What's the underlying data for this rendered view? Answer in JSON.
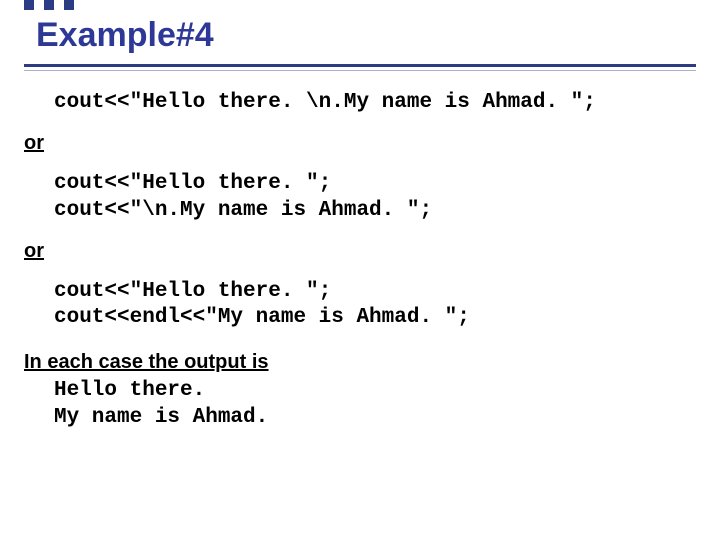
{
  "title": "Example#4",
  "code1": "cout<<\"Hello there. \\n.My name is Ahmad. \";",
  "or1": "or",
  "code2": "cout<<\"Hello there. \";\ncout<<\"\\n.My name is Ahmad. \";",
  "or2": "or",
  "code3": "cout<<\"Hello there. \";\ncout<<endl<<\"My name is Ahmad. \";",
  "summary_heading": "In each case the output is",
  "output": "Hello there.\nMy name is Ahmad."
}
